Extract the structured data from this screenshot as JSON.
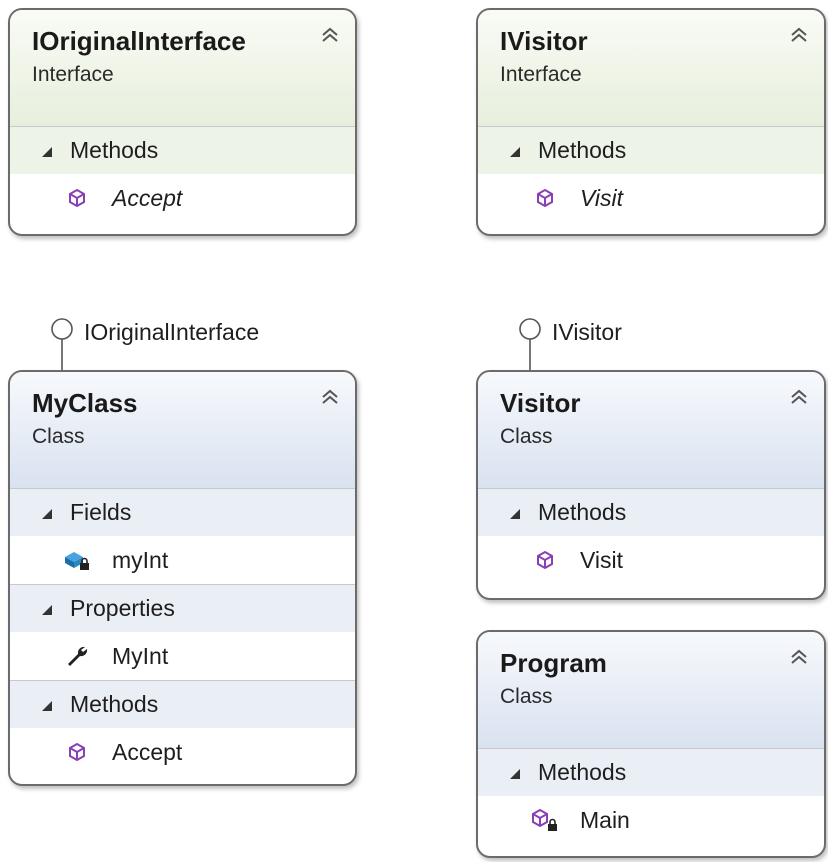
{
  "boxes": {
    "ioriginal": {
      "title": "IOriginalInterface",
      "kind": "Interface",
      "sections": [
        {
          "label": "Methods",
          "members": [
            "Accept"
          ]
        }
      ]
    },
    "ivisitor": {
      "title": "IVisitor",
      "kind": "Interface",
      "sections": [
        {
          "label": "Methods",
          "members": [
            "Visit"
          ]
        }
      ]
    },
    "myclass": {
      "title": "MyClass",
      "kind": "Class",
      "implements": "IOriginalInterface",
      "sections": [
        {
          "label": "Fields",
          "members": [
            "myInt"
          ]
        },
        {
          "label": "Properties",
          "members": [
            "MyInt"
          ]
        },
        {
          "label": "Methods",
          "members": [
            "Accept"
          ]
        }
      ]
    },
    "visitor": {
      "title": "Visitor",
      "kind": "Class",
      "implements": "IVisitor",
      "sections": [
        {
          "label": "Methods",
          "members": [
            "Visit"
          ]
        }
      ]
    },
    "program": {
      "title": "Program",
      "kind": "Class",
      "sections": [
        {
          "label": "Methods",
          "members": [
            "Main"
          ]
        }
      ]
    }
  },
  "icons": {
    "collapse": "double-chevron-up-icon",
    "section": "expanded-triangle-icon",
    "method": "purple-cube-method-icon",
    "field": "blue-field-lock-icon",
    "property": "wrench-icon",
    "private_method": "purple-cube-lock-icon"
  },
  "colors": {
    "interface_header": "#e7efdc",
    "class_header": "#d9e2f0",
    "border": "#6b6b6b",
    "method_icon": "#8a3fb5",
    "field_icon": "#1f7fc4"
  }
}
